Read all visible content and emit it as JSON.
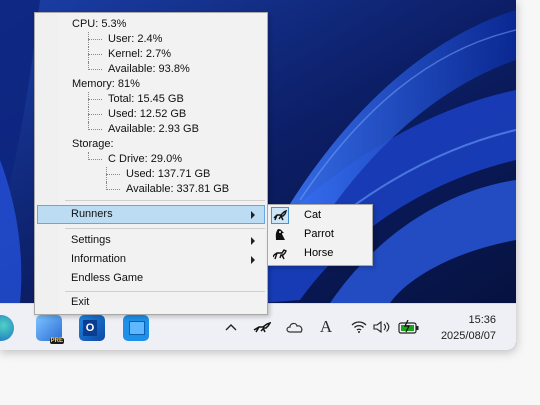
{
  "stats": {
    "cpu_label": "CPU: 5.3%",
    "cpu_user": "User: 2.4%",
    "cpu_kernel": "Kernel: 2.7%",
    "cpu_available": "Available: 93.8%",
    "memory_label": "Memory: 81%",
    "memory_total": "Total: 15.45 GB",
    "memory_used": "Used: 12.52 GB",
    "memory_available": "Available: 2.93 GB",
    "storage_label": "Storage:",
    "drive_label": "C Drive: 29.0%",
    "drive_used": "Used: 137.71 GB",
    "drive_available": "Available: 337.81 GB"
  },
  "menu": {
    "runners": "Runners",
    "settings": "Settings",
    "information": "Information",
    "endless_game": "Endless Game",
    "exit": "Exit"
  },
  "submenu": {
    "items": [
      {
        "label": "Cat",
        "icon": "cat-runner-icon",
        "selected": true
      },
      {
        "label": "Parrot",
        "icon": "parrot-icon",
        "selected": false
      },
      {
        "label": "Horse",
        "icon": "horse-icon",
        "selected": false
      }
    ]
  },
  "taskbar": {
    "apps": [
      "edge-icon",
      "copilot-pre-icon",
      "outlook-icon",
      "store-icon"
    ],
    "tray": [
      "chevron-up-icon",
      "cat-runner-tray-icon",
      "cloud-icon",
      "font-ime-icon",
      "wifi-icon",
      "speaker-icon",
      "battery-icon"
    ],
    "ime_glyph": "A",
    "time": "15:36",
    "date": "2025/08/07",
    "pre_badge": "PRE"
  },
  "colors": {
    "menu_bg": "#f2f2f2",
    "highlight": "#bcdcf4",
    "highlight_border": "#66a7e1",
    "wallpaper": "#0b1a55"
  }
}
